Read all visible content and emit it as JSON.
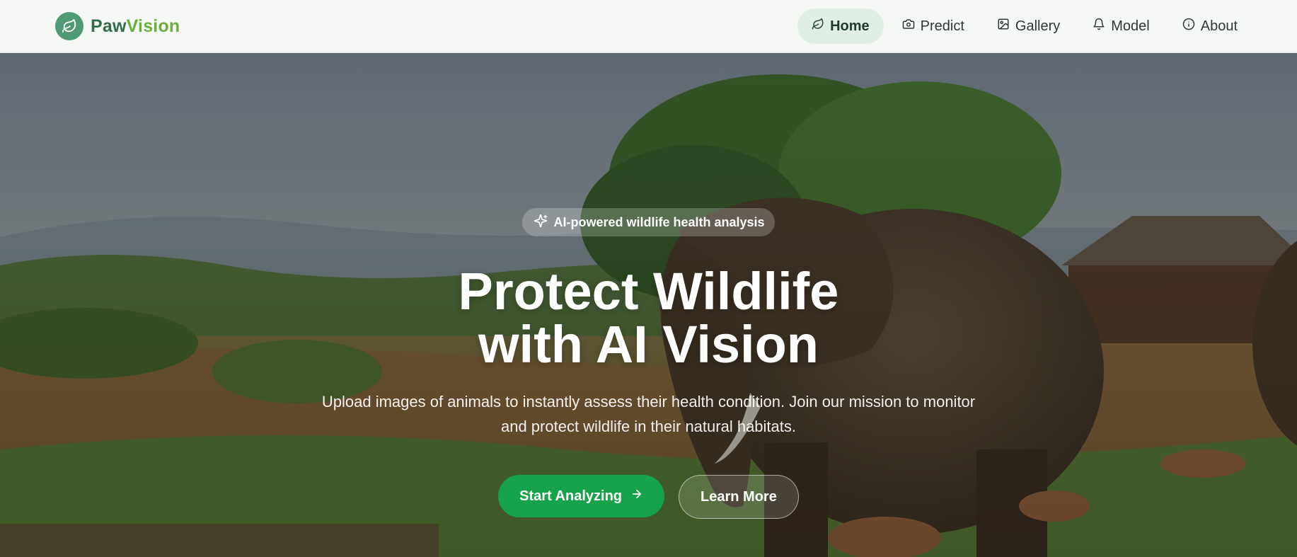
{
  "brand": {
    "name_part1": "Paw",
    "name_part2": "Vision",
    "logo_icon": "leaf-icon",
    "colors": {
      "part1": "#2f6f4c",
      "part2": "#6cae3d",
      "logo_bg": "#4d9a74"
    }
  },
  "nav": {
    "items": [
      {
        "label": "Home",
        "icon": "leaf-icon",
        "active": true
      },
      {
        "label": "Predict",
        "icon": "camera-icon",
        "active": false
      },
      {
        "label": "Gallery",
        "icon": "image-icon",
        "active": false
      },
      {
        "label": "Model",
        "icon": "bell-icon",
        "active": false
      },
      {
        "label": "About",
        "icon": "info-icon",
        "active": false
      }
    ]
  },
  "hero": {
    "background_image": "elephant-savanna-photo",
    "badge": {
      "icon": "sparkles-icon",
      "text": "AI-powered wildlife health analysis"
    },
    "headline_line1": "Protect Wildlife",
    "headline_line2": "with AI Vision",
    "subtitle": "Upload images of animals to instantly assess their health condition. Join our mission to monitor and protect wildlife in their natural habitats.",
    "primary_cta": {
      "label": "Start Analyzing",
      "icon": "arrow-right-icon"
    },
    "secondary_cta": {
      "label": "Learn More"
    },
    "colors": {
      "primary_button": "#16a34a",
      "text": "#ffffff"
    }
  }
}
